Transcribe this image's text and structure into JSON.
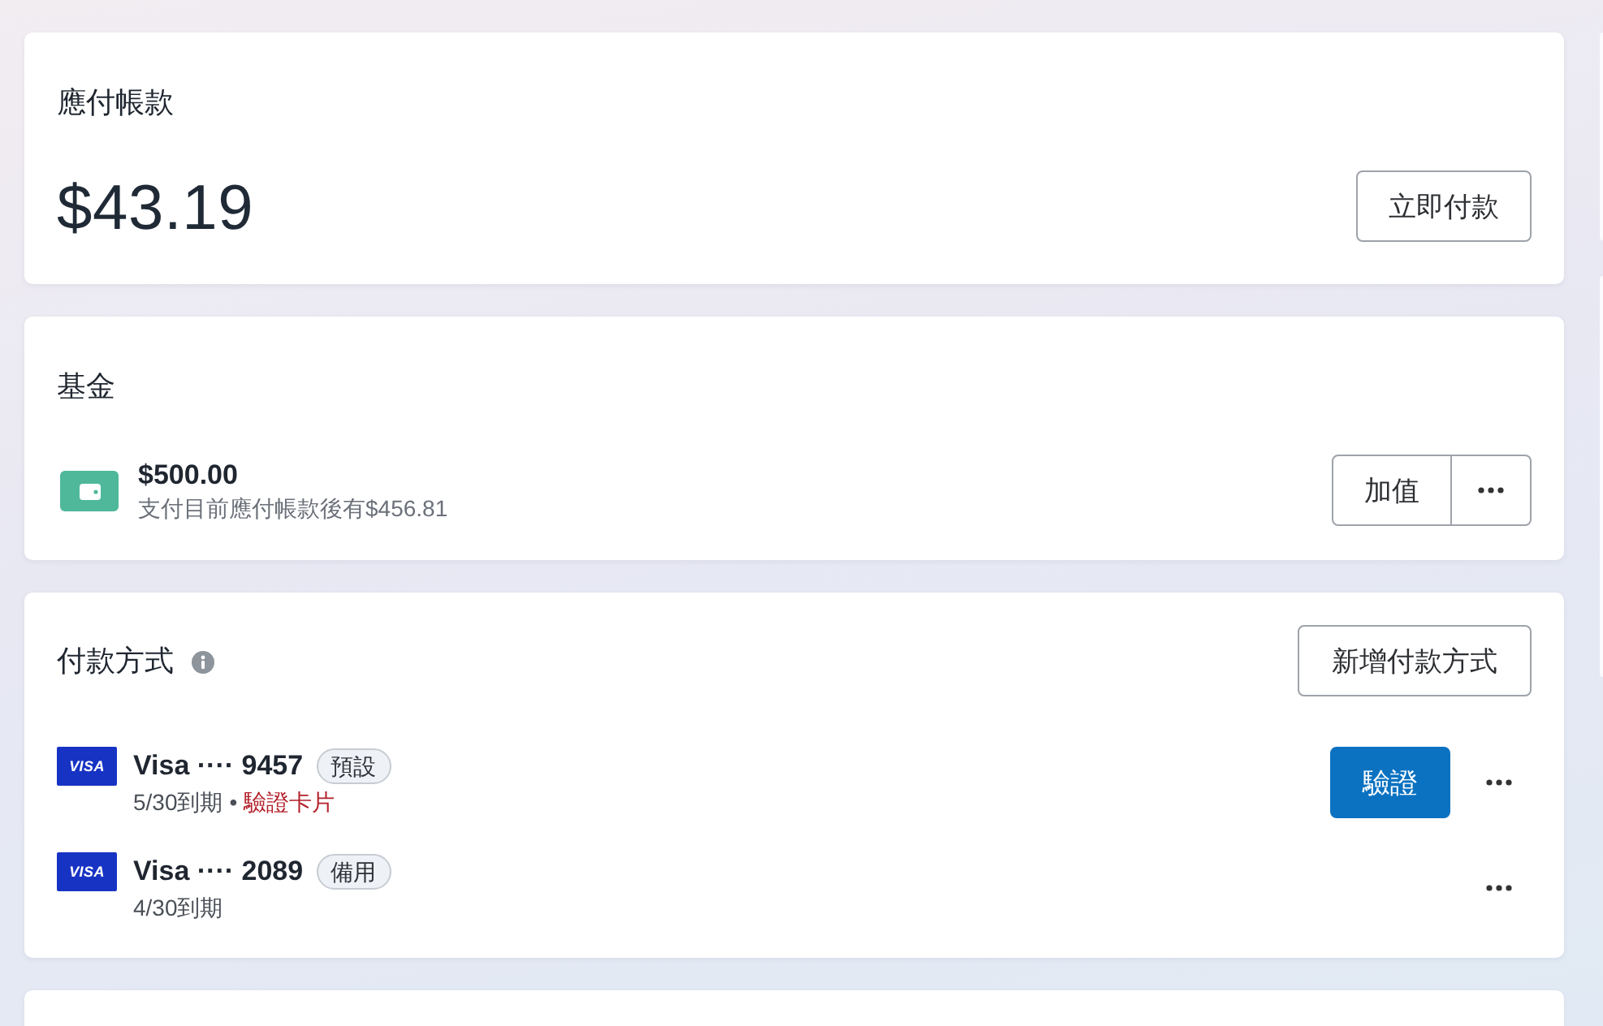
{
  "payable": {
    "title": "應付帳款",
    "amount": "$43.19",
    "pay_button": "立即付款"
  },
  "funds": {
    "title": "基金",
    "balance": "$500.00",
    "note": "支付目前應付帳款後有$456.81",
    "top_up_button": "加值"
  },
  "payment_methods": {
    "title": "付款方式",
    "add_button": "新增付款方式",
    "methods": [
      {
        "logo": "VISA",
        "name": "Visa ···· 9457",
        "badge": "預設",
        "expiry": "5/30到期",
        "separator": "•",
        "alert": "驗證卡片",
        "action": "驗證"
      },
      {
        "logo": "VISA",
        "name": "Visa ···· 2089",
        "badge": "備用",
        "expiry": "4/30到期"
      }
    ]
  }
}
